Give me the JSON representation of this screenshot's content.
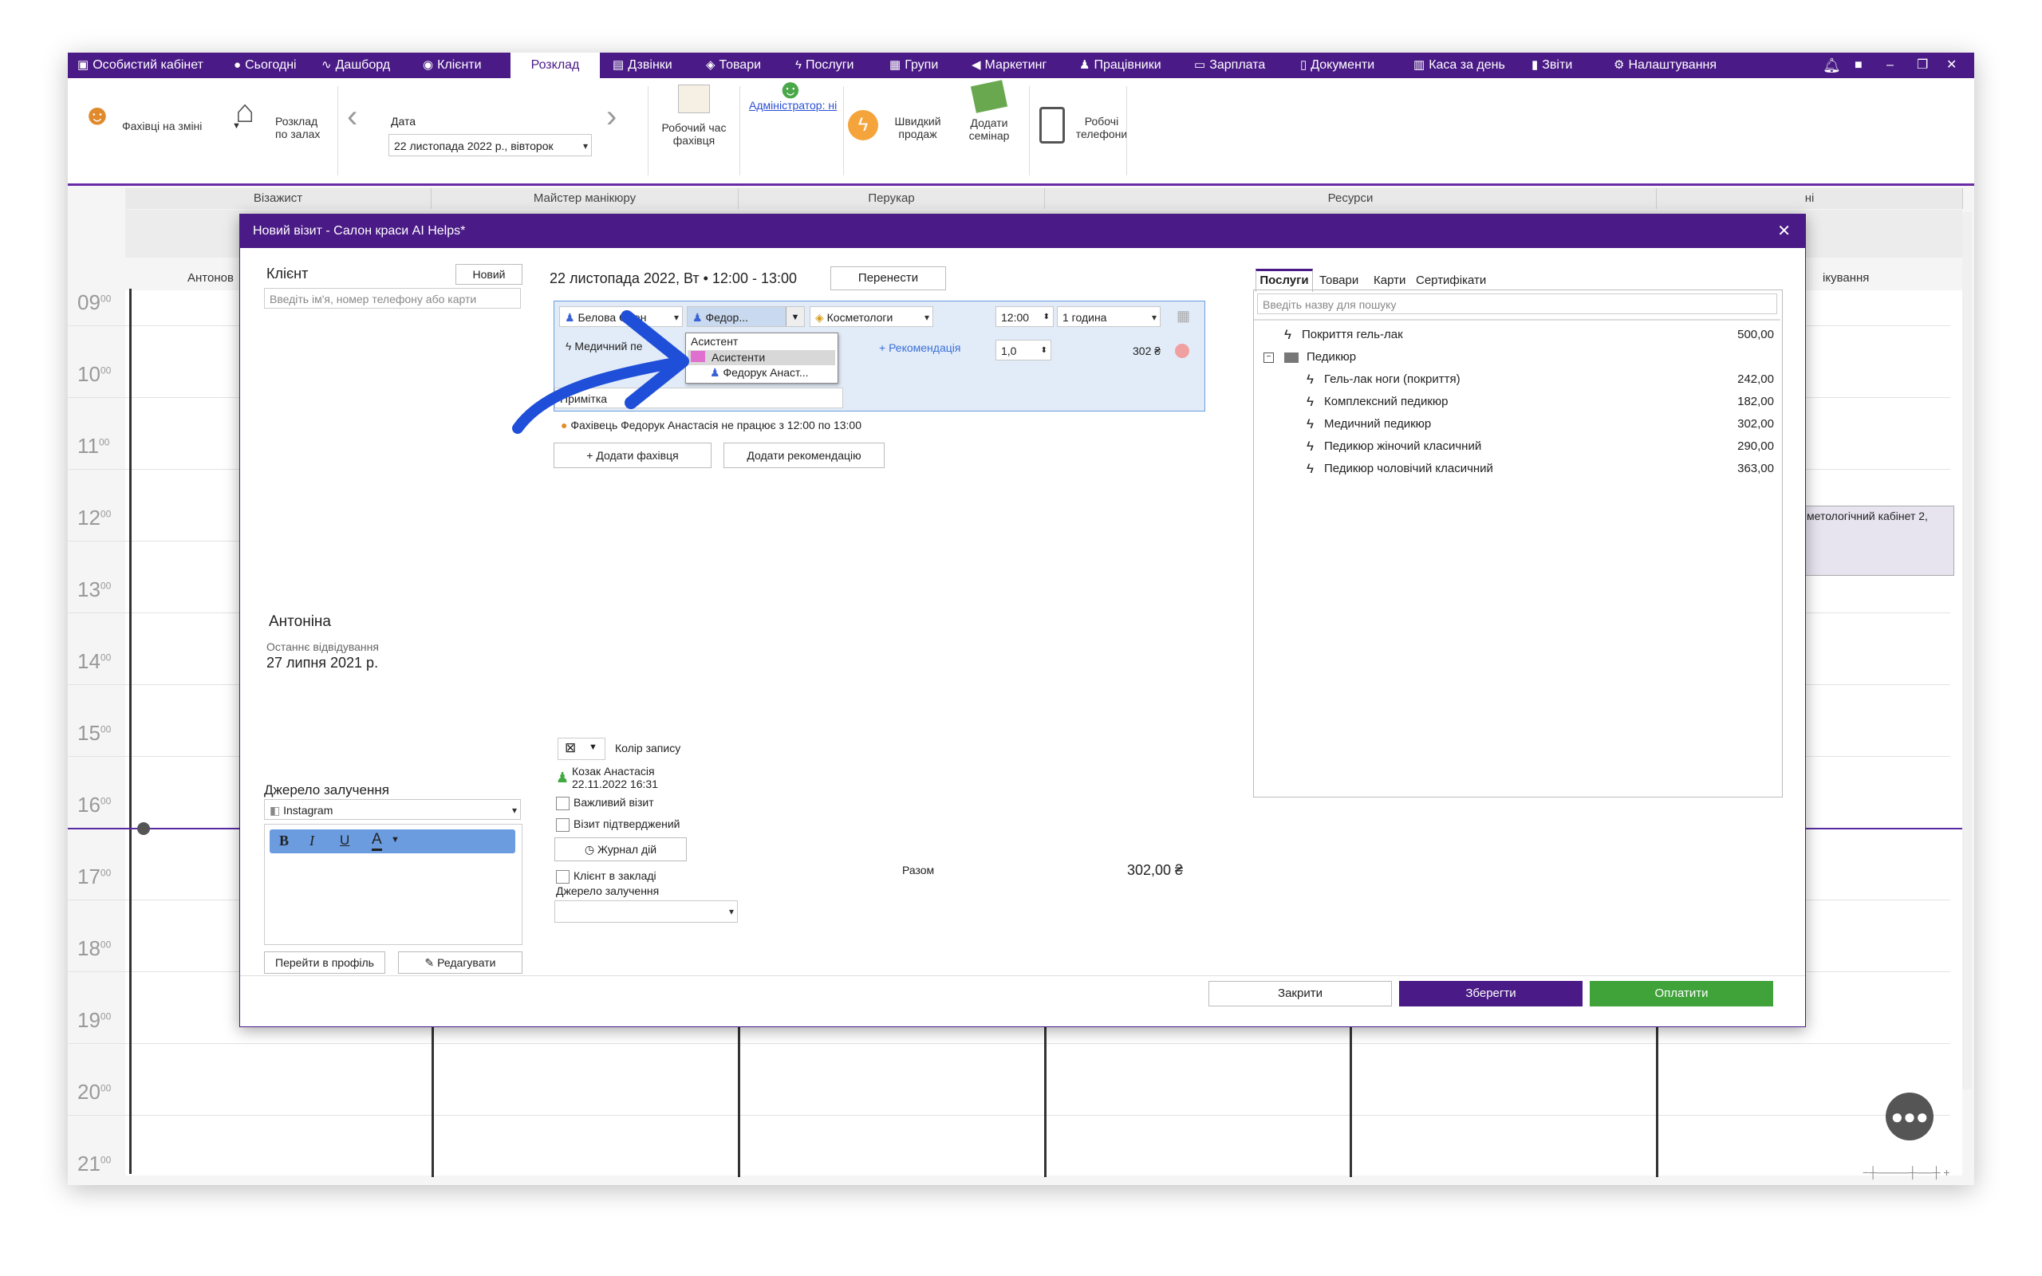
{
  "topnav": {
    "items": [
      "Особистий кабінет",
      "Сьогодні",
      "Дашборд",
      "Клієнти",
      "Розклад",
      "Дзвінки",
      "Товари",
      "Послуги",
      "Групи",
      "Маркетинг",
      "Працівники",
      "Зарплата",
      "Документи",
      "Каса за день",
      "Звіти",
      "Налаштування"
    ],
    "active": "Розклад"
  },
  "ribbon": {
    "staff_on_shift": "Фахівці на зміні",
    "schedule_by_halls": "Розклад по залах",
    "date_label": "Дата",
    "date_value": "22 листопада 2022 р., вівторок",
    "work_time": "Робочий час фахівця",
    "administrator": "Адміністратор: ні",
    "quick_sale": "Швидкий продаж",
    "add_seminar": "Додати семінар",
    "work_phones": "Робочі телефони"
  },
  "calendar": {
    "columns": [
      "Візажист",
      "Майстер манікюру",
      "Перукар",
      "Ресурси",
      "ні"
    ],
    "staff_col": "Антонов",
    "right_col": "ікування",
    "hours": [
      "09",
      "10",
      "11",
      "12",
      "13",
      "14",
      "15",
      "16",
      "17",
      "18",
      "19",
      "20",
      "21"
    ],
    "hour_minutes": "00",
    "event_text": "метологічний кабінет 2,"
  },
  "modal": {
    "title": "Новий візит - Салон краси AI Helps*",
    "client_label": "Клієнт",
    "new_button": "Новий",
    "client_placeholder": "Введіть ім'я, номер телефону або карти",
    "visit_datetime": "22 листопада 2022, Вт • 12:00 - 13:00",
    "move_button": "Перенести",
    "staff_select": "Белова Олен",
    "assistant_select": "Федор...",
    "category_select": "Косметологи",
    "time_value": "12:00",
    "duration_value": "1 година",
    "service_name": "Медичний пе",
    "recommendation_link": "+ Рекомендація",
    "quantity": "1,0",
    "service_price": "302 ₴",
    "note_placeholder": "Примітка",
    "dropdown": {
      "header": "Асистент",
      "group": "Асистенти",
      "person": "Федорук Анаст..."
    },
    "warning": "Фахівець Федорук Анастасія не працює з 12:00 по 13:00",
    "add_staff_button": "Додати фахівця",
    "add_recommendation_button": "Додати рекомендацію",
    "client_name": "Антоніна",
    "last_visit_label": "Останнє відвідування",
    "last_visit_date": "27 липня 2021 р.",
    "source_label": "Джерело залучення",
    "source_value": "Instagram",
    "go_profile_button": "Перейти в профіль",
    "edit_button": "Редагувати",
    "color_label": "Колір запису",
    "creator_name": "Козак Анастасія",
    "creator_date": "22.11.2022 16:31",
    "important_visit": "Важливий візит",
    "visit_confirmed": "Візит підтверджений",
    "action_log": "Журнал дій",
    "client_in_salon": "Клієнт в закладі",
    "source_label_2": "Джерело залучення",
    "total_label": "Разом",
    "total_value": "302,00 ₴",
    "tabs": [
      "Послуги",
      "Товари",
      "Карти",
      "Сертифікати"
    ],
    "search_placeholder": "Введіть назву для пошуку",
    "services": [
      {
        "name": "Покриття гель-лак",
        "price": "500,00",
        "level": 0,
        "type": "service"
      },
      {
        "name": "Педикюр",
        "price": "",
        "level": 0,
        "type": "folder"
      },
      {
        "name": "Гель-лак ноги (покриття)",
        "price": "242,00",
        "level": 1,
        "type": "service"
      },
      {
        "name": "Комплексний педикюр",
        "price": "182,00",
        "level": 1,
        "type": "service"
      },
      {
        "name": "Медичний педикюр",
        "price": "302,00",
        "level": 1,
        "type": "service"
      },
      {
        "name": "Педикюр жіночий класичний",
        "price": "290,00",
        "level": 1,
        "type": "service"
      },
      {
        "name": "Педикюр чоловічий класичний",
        "price": "363,00",
        "level": 1,
        "type": "service"
      }
    ],
    "close_button": "Закрити",
    "save_button": "Зберегти",
    "pay_button": "Оплатити"
  },
  "colors": {
    "brand_purple": "#4a1a86",
    "pay_green": "#3fa33a",
    "highlight_blue": "#2e6bd9",
    "annotation_arrow": "#1f4fd8"
  }
}
